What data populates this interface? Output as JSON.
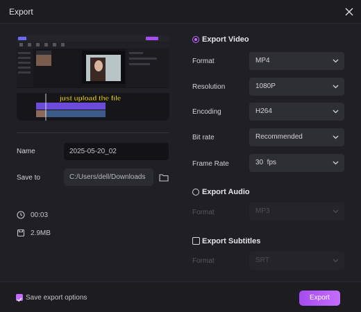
{
  "window": {
    "title": "Export"
  },
  "preview": {
    "caption": "just upload the file"
  },
  "left": {
    "name_label": "Name",
    "name_value": "2025-05-20_02",
    "save_to_label": "Save to",
    "save_to_value": "C:/Users/dell/Downloads",
    "duration": "00:03",
    "file_size": "2.9MB"
  },
  "export_video": {
    "title": "Export Video",
    "selected": true,
    "rows": [
      {
        "label": "Format",
        "value": "MP4"
      },
      {
        "label": "Resolution",
        "value": "1080P"
      },
      {
        "label": "Encoding",
        "value": "H264"
      },
      {
        "label": "Bit rate",
        "value": "Recommended"
      },
      {
        "label": "Frame Rate",
        "value": "30  fps"
      }
    ]
  },
  "export_audio": {
    "title": "Export Audio",
    "selected": false,
    "format_label": "Format",
    "format_value": "MP3"
  },
  "export_subtitles": {
    "title": "Export Subtitles",
    "checked": false,
    "format_label": "Format",
    "format_value": "SRT"
  },
  "footer": {
    "save_options_label": "Save export options",
    "save_options_checked": true,
    "export_label": "Export"
  },
  "colors": {
    "accent": "#c26bff",
    "background": "#1f1f25"
  }
}
